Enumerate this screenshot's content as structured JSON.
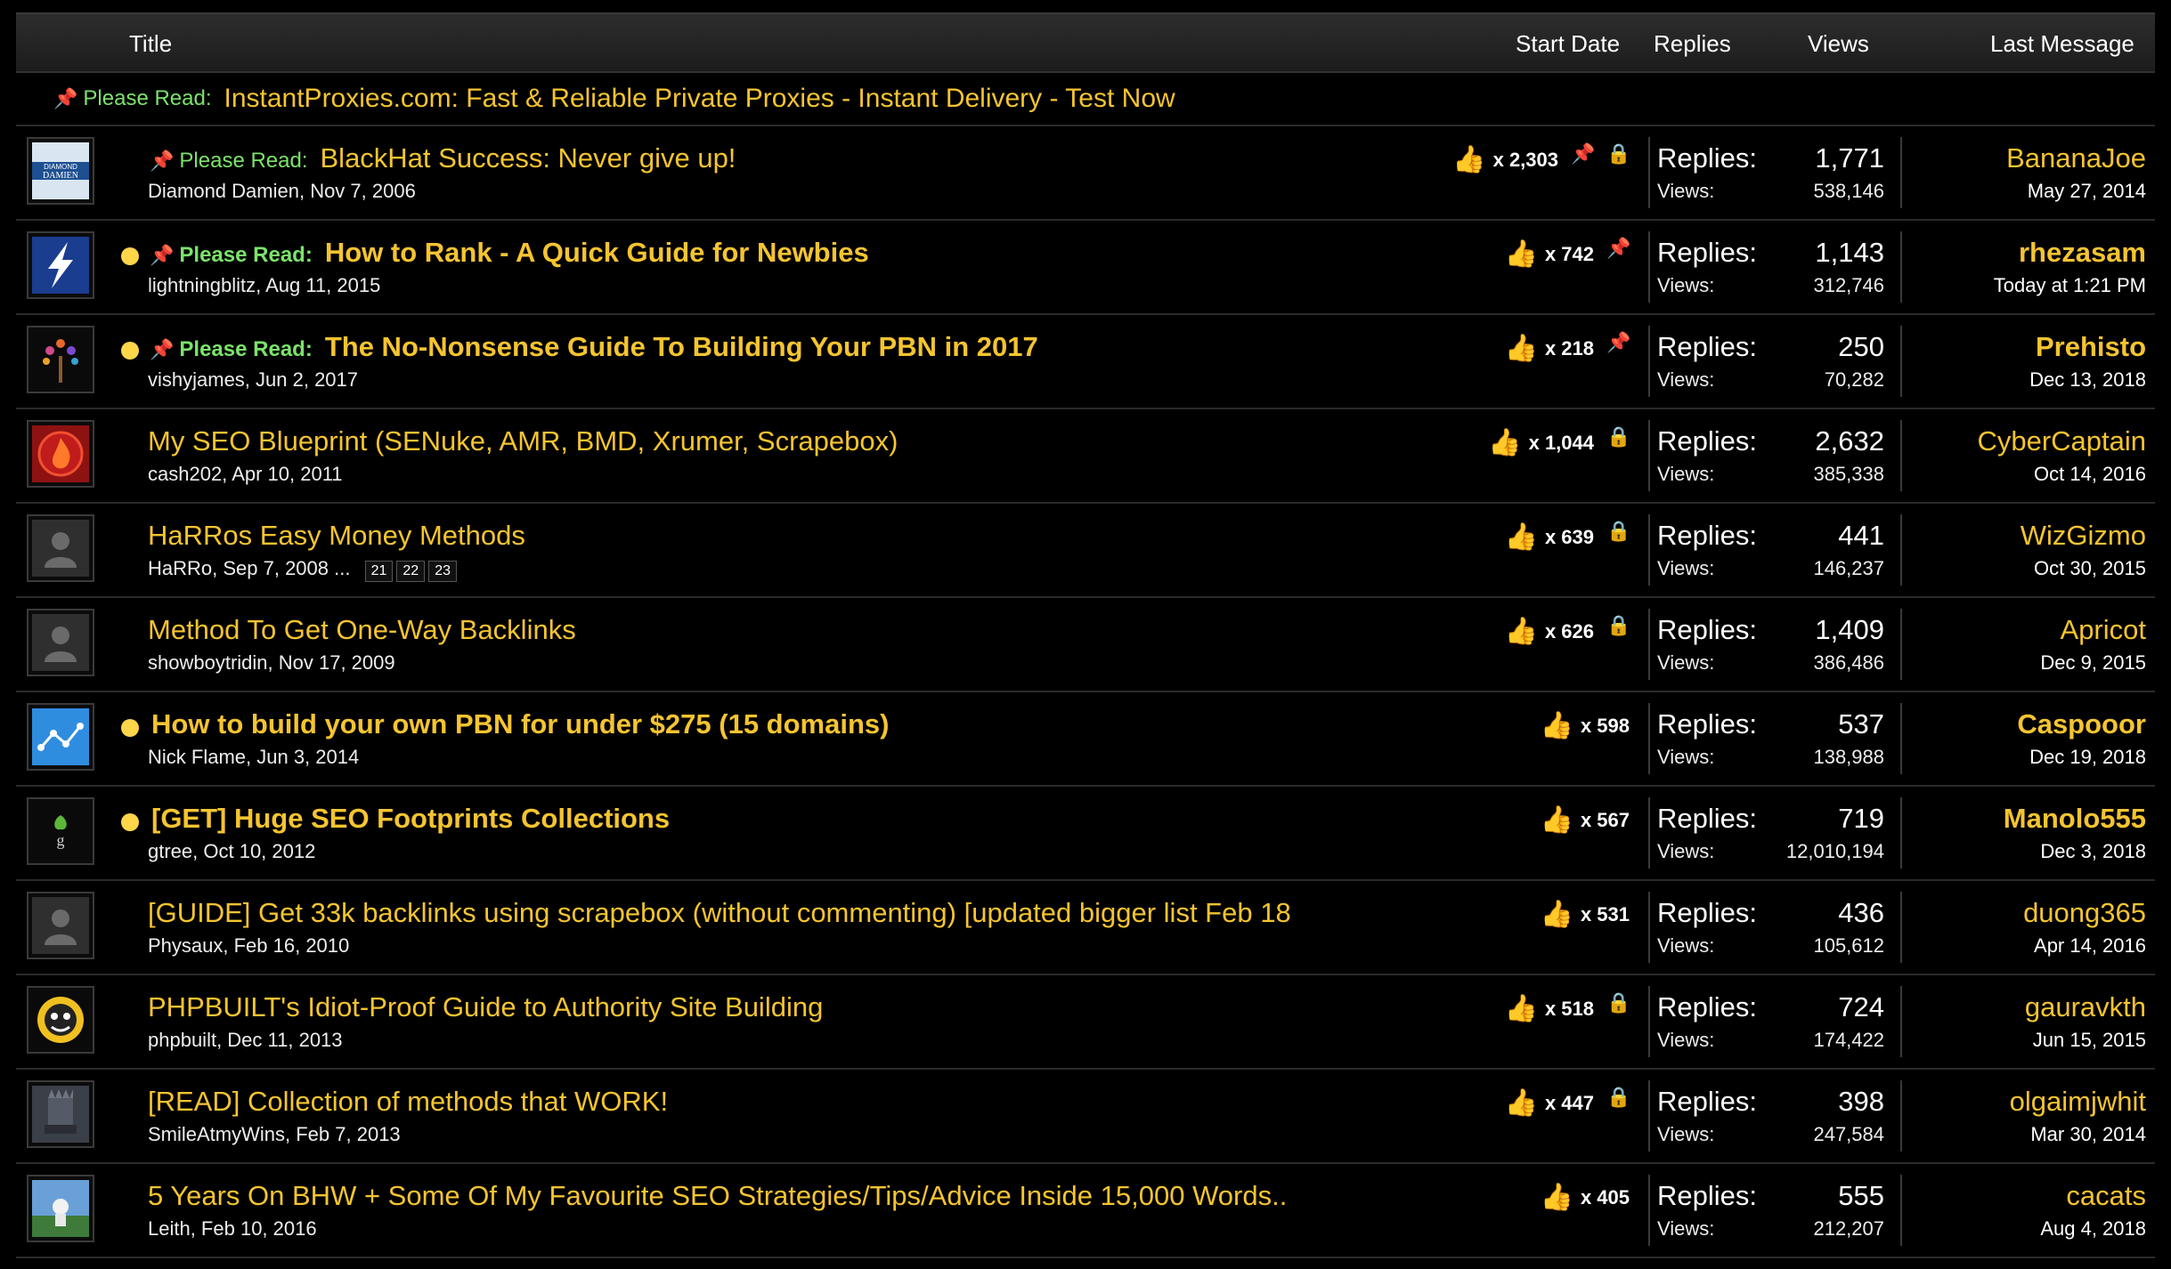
{
  "header": {
    "title": "Title",
    "start_date": "Start Date",
    "replies": "Replies",
    "views": "Views",
    "last_message": "Last Message"
  },
  "sticky_ad": {
    "prefix": "Please Read:",
    "text": "InstantProxies.com: Fast & Reliable Private Proxies - Instant Delivery - Test Now"
  },
  "labels": {
    "please_read": "Please Read:",
    "replies": "Replies:",
    "views": "Views:"
  },
  "threads": [
    {
      "title": "BlackHat Success: Never give up!",
      "author_date": "Diamond Damien, Nov 7, 2006",
      "likes": "x 2,303",
      "replies": "1,771",
      "views": "538,146",
      "last_user": "BananaJoe",
      "last_date": "May 27, 2014",
      "please_read": true,
      "unread": false,
      "bold": false,
      "pin": true,
      "lock": true,
      "avatar": "diamond-damien"
    },
    {
      "title": "How to Rank - A Quick Guide for Newbies",
      "author_date": "lightningblitz, Aug 11, 2015",
      "likes": "x 742",
      "replies": "1,143",
      "views": "312,746",
      "last_user": "rhezasam",
      "last_date": "Today at 1:21 PM",
      "please_read": true,
      "unread": true,
      "bold": true,
      "pin": true,
      "lock": false,
      "avatar": "lightning"
    },
    {
      "title": "The No-Nonsense Guide To Building Your PBN in 2017",
      "author_date": "vishyjames, Jun 2, 2017",
      "likes": "x 218",
      "replies": "250",
      "views": "70,282",
      "last_user": "Prehisto",
      "last_date": "Dec 13, 2018",
      "please_read": true,
      "unread": true,
      "bold": true,
      "pin": true,
      "lock": false,
      "avatar": "tree"
    },
    {
      "title": "My SEO Blueprint (SENuke, AMR, BMD, Xrumer, Scrapebox)",
      "author_date": "cash202, Apr 10, 2011",
      "likes": "x 1,044",
      "replies": "2,632",
      "views": "385,338",
      "last_user": "CyberCaptain",
      "last_date": "Oct 14, 2016",
      "please_read": false,
      "unread": false,
      "bold": false,
      "pin": false,
      "lock": true,
      "avatar": "fire"
    },
    {
      "title": "HaRRos Easy Money Methods",
      "author_date": "HaRRo, Sep 7, 2008",
      "pages": [
        "21",
        "22",
        "23"
      ],
      "likes": "x 639",
      "replies": "441",
      "views": "146,237",
      "last_user": "WizGizmo",
      "last_date": "Oct 30, 2015",
      "please_read": false,
      "unread": false,
      "bold": false,
      "pin": false,
      "lock": true,
      "avatar": "default"
    },
    {
      "title": "Method To Get One-Way Backlinks",
      "author_date": "showboytridin, Nov 17, 2009",
      "likes": "x 626",
      "replies": "1,409",
      "views": "386,486",
      "last_user": "Apricot",
      "last_date": "Dec 9, 2015",
      "please_read": false,
      "unread": false,
      "bold": false,
      "pin": false,
      "lock": true,
      "avatar": "default"
    },
    {
      "title": "How to build your own PBN for under $275 (15 domains)",
      "author_date": "Nick Flame, Jun 3, 2014",
      "likes": "x 598",
      "replies": "537",
      "views": "138,988",
      "last_user": "Caspooor",
      "last_date": "Dec 19, 2018",
      "please_read": false,
      "unread": true,
      "bold": true,
      "pin": false,
      "lock": false,
      "avatar": "network"
    },
    {
      "title": "[GET] Huge SEO Footprints Collections",
      "author_date": "gtree, Oct 10, 2012",
      "likes": "x 567",
      "replies": "719",
      "views": "12,010,194",
      "last_user": "Manolo555",
      "last_date": "Dec 3, 2018",
      "please_read": false,
      "unread": true,
      "bold": true,
      "pin": false,
      "lock": false,
      "avatar": "gtree"
    },
    {
      "title": "[GUIDE] Get 33k backlinks using scrapebox (without commenting) [updated bigger list Feb 18",
      "author_date": "Physaux, Feb 16, 2010",
      "likes": "x 531",
      "replies": "436",
      "views": "105,612",
      "last_user": "duong365",
      "last_date": "Apr 14, 2016",
      "please_read": false,
      "unread": false,
      "bold": false,
      "pin": false,
      "lock": false,
      "avatar": "default"
    },
    {
      "title": "PHPBUILT's Idiot-Proof Guide to Authority Site Building",
      "author_date": "phpbuilt, Dec 11, 2013",
      "likes": "x 518",
      "replies": "724",
      "views": "174,422",
      "last_user": "gauravkth",
      "last_date": "Jun 15, 2015",
      "please_read": false,
      "unread": false,
      "bold": false,
      "pin": false,
      "lock": true,
      "avatar": "face"
    },
    {
      "title": "[READ] Collection of methods that WORK!",
      "author_date": "SmileAtmyWins, Feb 7, 2013",
      "likes": "x 447",
      "replies": "398",
      "views": "247,584",
      "last_user": "olgaimjwhit",
      "last_date": "Mar 30, 2014",
      "please_read": false,
      "unread": false,
      "bold": false,
      "pin": false,
      "lock": true,
      "avatar": "throne"
    },
    {
      "title": "5 Years On BHW + Some Of My Favourite SEO Strategies/Tips/Advice Inside 15,000 Words..",
      "author_date": "Leith, Feb 10, 2016",
      "likes": "x 405",
      "replies": "555",
      "views": "212,207",
      "last_user": "cacats",
      "last_date": "Aug 4, 2018",
      "please_read": false,
      "unread": false,
      "bold": false,
      "pin": false,
      "lock": false,
      "avatar": "photo"
    }
  ]
}
